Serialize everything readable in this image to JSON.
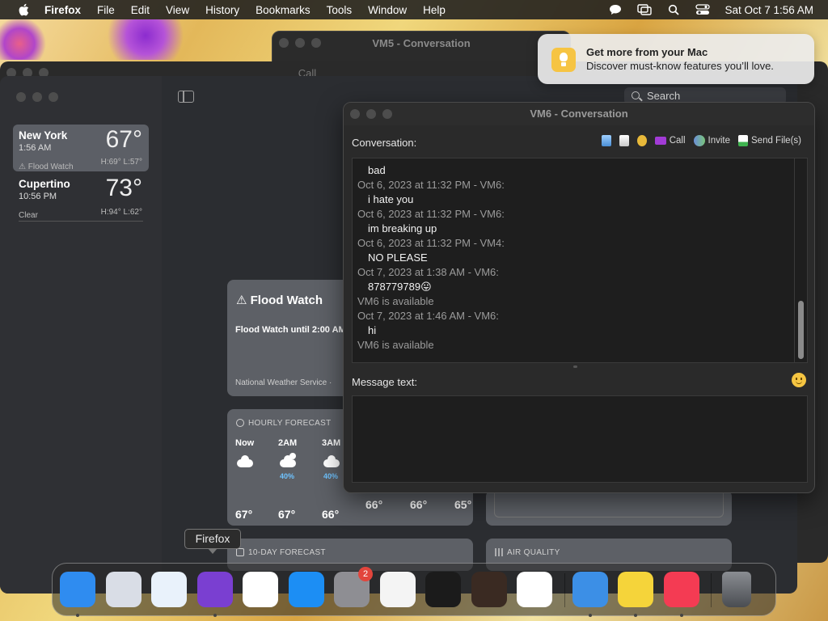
{
  "menubar": {
    "app": "Firefox",
    "items": [
      "File",
      "Edit",
      "View",
      "History",
      "Bookmarks",
      "Tools",
      "Window",
      "Help"
    ],
    "datetime": "Sat Oct 7  1:56 AM"
  },
  "windows": {
    "vm5_title": "VM5 - Conversation",
    "call_title": "Call",
    "vm6_title": "VM6 - Conversation"
  },
  "notification": {
    "title": "Get more from your Mac",
    "body": "Discover must-know features you’ll love."
  },
  "weather": {
    "search_placeholder": "Search",
    "locations": [
      {
        "city": "New York",
        "time": "1:56 AM",
        "temp": "67°",
        "condition": "⚠ Flood Watch",
        "hilo": "H:69°  L:57°"
      },
      {
        "city": "Cupertino",
        "time": "10:56 PM",
        "temp": "73°",
        "condition": "Clear",
        "hilo": "H:94°  L:62°"
      }
    ],
    "flood": {
      "heading": "⚠ Flood Watch",
      "text": "Flood Watch until 2:00 AM",
      "source": "National Weather Service ·"
    },
    "hourly": {
      "heading": "HOURLY FORECAST",
      "hours": [
        {
          "label": "Now",
          "pct": "",
          "temp": "67°",
          "icon": "cloud-icon"
        },
        {
          "label": "2AM",
          "pct": "40%",
          "temp": "67°",
          "icon": "cloud-rain-icon"
        },
        {
          "label": "3AM",
          "pct": "40%",
          "temp": "66°",
          "icon": "cloud-rain-icon"
        },
        {
          "label": "",
          "pct": "",
          "temp": "66°",
          "icon": ""
        },
        {
          "label": "",
          "pct": "",
          "temp": "66°",
          "icon": ""
        },
        {
          "label": "",
          "pct": "",
          "temp": "65°",
          "icon": ""
        }
      ]
    },
    "tenday_heading": "10-DAY FORECAST",
    "air_heading": "AIR QUALITY"
  },
  "conversation": {
    "label": "Conversation:",
    "toolbar": {
      "call": "Call",
      "invite": "Invite",
      "send_files": "Send File(s)"
    },
    "messages": [
      {
        "kind": "body",
        "text": "bad"
      },
      {
        "kind": "head",
        "text": "Oct 6, 2023 at 11:32 PM - VM6:"
      },
      {
        "kind": "body",
        "text": "i hate you"
      },
      {
        "kind": "head",
        "text": "Oct 6, 2023 at 11:32 PM - VM6:"
      },
      {
        "kind": "body",
        "text": "im breaking up"
      },
      {
        "kind": "head",
        "text": "Oct 6, 2023 at 11:32 PM - VM4:"
      },
      {
        "kind": "body",
        "text": "NO PLEASE"
      },
      {
        "kind": "head",
        "text": "Oct 7, 2023 at 1:38 AM - VM6:"
      },
      {
        "kind": "body",
        "text": "878779789😛"
      },
      {
        "kind": "status",
        "text": "VM6 is available"
      },
      {
        "kind": "head",
        "text": "Oct 7, 2023 at 1:46 AM - VM6:"
      },
      {
        "kind": "body",
        "text": "hi"
      },
      {
        "kind": "status",
        "text": "VM6 is available"
      }
    ],
    "message_label": "Message text:",
    "message_value": ""
  },
  "dock": {
    "tooltip": "Firefox",
    "apps": [
      {
        "name": "finder-icon",
        "color": "#2f8cf0",
        "running": true
      },
      {
        "name": "launchpad-icon",
        "color": "#d9dde6",
        "running": false
      },
      {
        "name": "safari-icon",
        "color": "#e9f2fb",
        "running": false
      },
      {
        "name": "firefox-icon",
        "color": "#7a3fd1",
        "running": true
      },
      {
        "name": "chrome-icon",
        "color": "#ffffff",
        "running": false
      },
      {
        "name": "app-store-icon",
        "color": "#1c8ef4",
        "running": false
      },
      {
        "name": "system-settings-icon",
        "color": "#8e8e93",
        "running": false,
        "badge": "2"
      },
      {
        "name": "textedit-icon",
        "color": "#f4f4f4",
        "running": false
      },
      {
        "name": "terminal-icon",
        "color": "#1b1b1b",
        "running": false
      },
      {
        "name": "garageband-icon",
        "color": "#3a2a22",
        "running": false
      },
      {
        "name": "vscode-icon",
        "color": "#ffffff",
        "running": false
      },
      {
        "name": "weather-icon",
        "color": "#3c8fe6",
        "running": true
      },
      {
        "name": "chat-icon",
        "color": "#f5d43a",
        "running": true
      },
      {
        "name": "music-icon",
        "color": "#f43b53",
        "running": true
      },
      {
        "name": "trash-icon",
        "color": "#5f6368",
        "running": false
      }
    ]
  }
}
